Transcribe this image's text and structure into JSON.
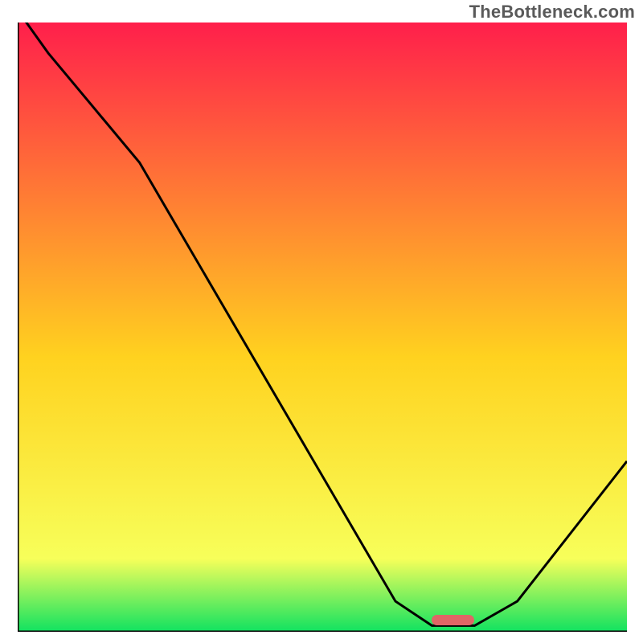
{
  "watermark": "TheBottleneck.com",
  "colors": {
    "gradient_top": "#ff1f4b",
    "gradient_mid": "#ffd21f",
    "gradient_low": "#f7ff5a",
    "gradient_bottom": "#10e260",
    "axis": "#000000",
    "curve": "#000000",
    "marker": "#e06666"
  },
  "chart_data": {
    "type": "line",
    "x": [
      0,
      5,
      20,
      62,
      68,
      75,
      82,
      100
    ],
    "values": [
      102,
      95,
      77,
      5,
      1,
      1,
      5,
      28
    ],
    "title": "",
    "xlabel": "",
    "ylabel": "",
    "xlim": [
      0,
      100
    ],
    "ylim": [
      0,
      100
    ],
    "marker": {
      "x_start": 68,
      "x_end": 75,
      "y": 2
    }
  }
}
